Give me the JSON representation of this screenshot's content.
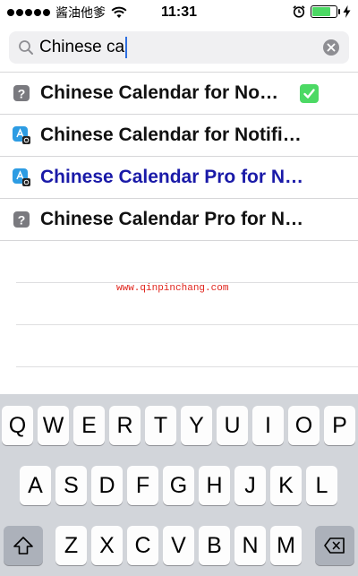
{
  "status_bar": {
    "carrier": "酱油他爹",
    "time": "11:31",
    "battery_level": 0.75
  },
  "search": {
    "query": "Chinese ca"
  },
  "results": [
    {
      "label": "Chinese Calendar for No…",
      "icon": "question-icon",
      "selected": true,
      "highlighted": false
    },
    {
      "label": "Chinese Calendar for Notifi…",
      "icon": "app-store-icon",
      "selected": false,
      "highlighted": false
    },
    {
      "label": "Chinese Calendar Pro for N…",
      "icon": "app-store-icon",
      "selected": false,
      "highlighted": true
    },
    {
      "label": "Chinese Calendar Pro for N…",
      "icon": "question-icon",
      "selected": false,
      "highlighted": false
    }
  ],
  "watermark": "www.qinpinchang.com",
  "keyboard": {
    "row1": [
      "Q",
      "W",
      "E",
      "R",
      "T",
      "Y",
      "U",
      "I",
      "O",
      "P"
    ],
    "row2": [
      "A",
      "S",
      "D",
      "F",
      "G",
      "H",
      "J",
      "K",
      "L"
    ],
    "row3": [
      "Z",
      "X",
      "C",
      "V",
      "B",
      "N",
      "M"
    ]
  },
  "colors": {
    "check_green": "#4cd964",
    "link_blue": "#1a1aa8",
    "caret_blue": "#2e6fe0",
    "keyboard_bg": "#d2d5da"
  }
}
